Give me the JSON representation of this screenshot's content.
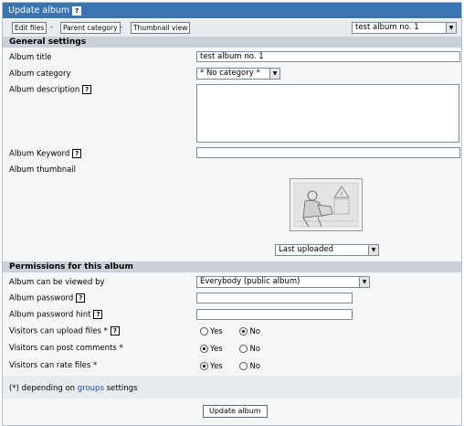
{
  "titlebar": {
    "title": "Update album",
    "help": "?"
  },
  "toolbar": {
    "edit_files": "Edit files",
    "separator": "-",
    "parent_category": "Parent category",
    "thumbnail_view": "Thumbnail view",
    "album_select": "test album no. 1"
  },
  "general": {
    "heading": "General settings",
    "album_title_label": "Album title",
    "album_title_value": "test album no. 1",
    "album_category_label": "Album category",
    "album_category_value": "* No category *",
    "album_description_label": "Album description",
    "album_keyword_label": "Album Keyword",
    "album_thumbnail_label": "Album thumbnail",
    "thumbnail_select": "Last uploaded"
  },
  "permissions": {
    "heading": "Permissions for this album",
    "viewed_by_label": "Album can be viewed by",
    "viewed_by_value": "Everybody (public album)",
    "password_label": "Album password",
    "password_hint_label": "Album password hint",
    "upload_label": "Visitors can upload files *",
    "comments_label": "Visitors can post comments *",
    "rate_label": "Visitors can rate files *",
    "yes": "Yes",
    "no": "No",
    "upload_choice": "No",
    "comments_choice": "Yes",
    "rate_choice": "Yes"
  },
  "footer": {
    "note_prefix": "(*) depending on",
    "note_link": "groups",
    "note_suffix": "settings",
    "submit": "Update album"
  }
}
